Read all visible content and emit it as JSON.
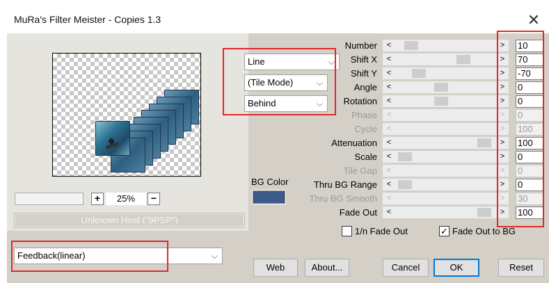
{
  "window": {
    "title": "MuRa's Filter Meister - Copies 1.3",
    "close_glyph": "✕"
  },
  "preview": {
    "zoom_minus": "−",
    "zoom_plus": "+",
    "zoom_value": "25%",
    "host_text": "Unknown Host (\"9PSP\")"
  },
  "dropdowns": {
    "mode": "Line",
    "tile_mode": "(Tile Mode)",
    "layer_order": "Behind",
    "feedback": "Feedback(linear)",
    "chevron": "⌵"
  },
  "bg_color": {
    "label": "BG Color",
    "color": "#3b5a8a"
  },
  "params": [
    {
      "label": "Number",
      "value": "10",
      "enabled": true,
      "pos": 0.12
    },
    {
      "label": "Shift X",
      "value": "70",
      "enabled": true,
      "pos": 0.7
    },
    {
      "label": "Shift Y",
      "value": "-70",
      "enabled": true,
      "pos": 0.2
    },
    {
      "label": "Angle",
      "value": "0",
      "enabled": true,
      "pos": 0.45
    },
    {
      "label": "Rotation",
      "value": "0",
      "enabled": true,
      "pos": 0.45
    },
    {
      "label": "Phase",
      "value": "0",
      "enabled": false,
      "pos": null
    },
    {
      "label": "Cycle",
      "value": "100",
      "enabled": false,
      "pos": null
    },
    {
      "label": "Attenuation",
      "value": "100",
      "enabled": true,
      "pos": 0.93
    },
    {
      "label": "Scale",
      "value": "0",
      "enabled": true,
      "pos": 0.05
    },
    {
      "label": "Tile Gap",
      "value": "0",
      "enabled": false,
      "pos": null
    },
    {
      "label": "Thru BG Range",
      "value": "0",
      "enabled": true,
      "pos": 0.05
    },
    {
      "label": "Thru BG Smooth",
      "value": "30",
      "enabled": false,
      "pos": null
    },
    {
      "label": "Fade Out",
      "value": "100",
      "enabled": true,
      "pos": 0.93
    }
  ],
  "checkboxes": {
    "fade_1n": {
      "label": "1/n Fade Out",
      "checked": false
    },
    "fade_bg": {
      "label": "Fade Out to BG",
      "checked": true
    }
  },
  "buttons": {
    "web": "Web",
    "about": "About...",
    "cancel": "Cancel",
    "ok": "OK",
    "reset": "Reset"
  },
  "colors": {
    "accent": "#0078d7",
    "highlight": "#e0262b"
  }
}
